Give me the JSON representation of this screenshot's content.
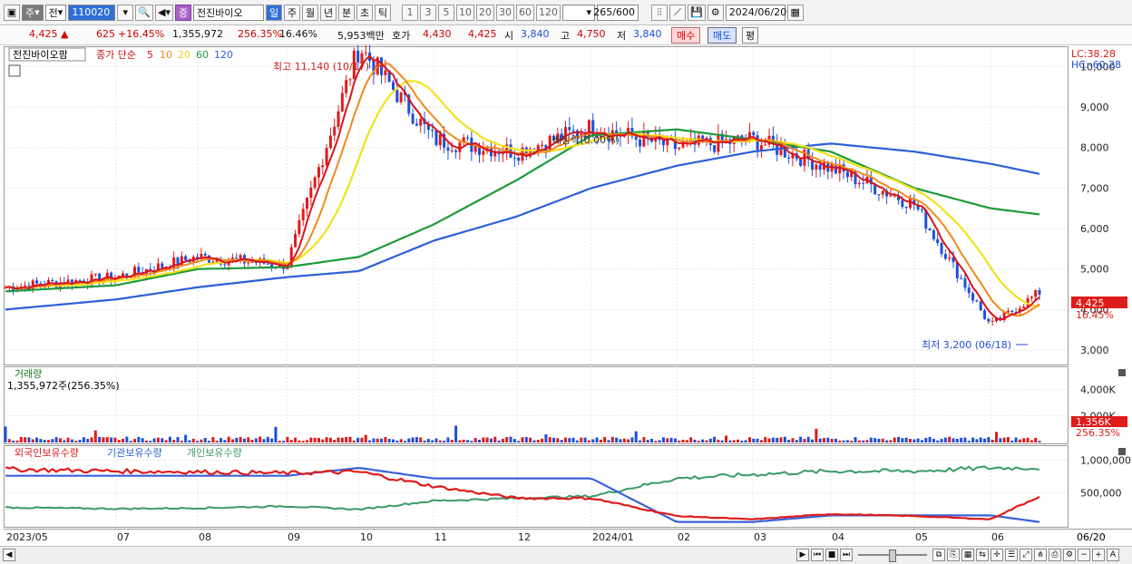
{
  "toolbar": {
    "period_label": "주",
    "market_label": "전",
    "stock_code": "110020",
    "badge_label": "증",
    "stock_name": "전진바이오",
    "tab_day": "일",
    "tab_week": "주",
    "tab_month": "월",
    "tab_year": "년",
    "tab_minute": "분",
    "tab_second": "초",
    "tab_tick": "틱",
    "intervals": [
      "1",
      "3",
      "5",
      "10",
      "20",
      "30",
      "60",
      "120"
    ],
    "count_value": "265",
    "count_total": "/600",
    "date_value": "2024/06/20"
  },
  "quote": {
    "price": "4,425",
    "change": "625",
    "change_pct": "+16.45%",
    "volume": "1,355,972",
    "volume_ratio": "256.35%",
    "turnover_pct": "16.46%",
    "amount": "5,953백만",
    "bid_label": "호가",
    "bid_high": "4,430",
    "bid_low": "4,425",
    "open_label": "시",
    "open_value": "3,840",
    "high_label": "고",
    "high_value": "4,750",
    "low_label": "저",
    "low_value": "3,840",
    "buy_label": "매수",
    "sell_label": "매도",
    "flat_label": "평"
  },
  "price_pane": {
    "title": "전진바이오팜",
    "indicator": "종가 단순",
    "ma_periods": [
      "5",
      "10",
      "20",
      "60",
      "120"
    ],
    "lc_label": "LC:38.28",
    "hc_label": "HC:-60.28",
    "max_label": "최고 11,140 (10/17)",
    "min_label": "최저 3,200 (06/18)",
    "event_label": "배당락(0.00%)",
    "current_price": "4,425",
    "current_pct": "16.45%",
    "y_ticks": [
      "10,000",
      "9,000",
      "8,000",
      "7,000",
      "6,000",
      "5,000",
      "4,000",
      "3,000"
    ]
  },
  "volume_pane": {
    "title": "거래량",
    "value": "1,355,972주(256.35%)",
    "y_ticks": [
      "4,000K",
      "2,000K"
    ],
    "current": "1,356K",
    "current_pct": "256.35%"
  },
  "holder_pane": {
    "foreign_label": "외국인보유수량",
    "inst_label": "기관보유수량",
    "indiv_label": "개인보유수량",
    "y_ticks": [
      "1,000,000",
      "500,000"
    ]
  },
  "x_axis": [
    "2023/05",
    "07",
    "08",
    "09",
    "10",
    "11",
    "12",
    "2024/01",
    "02",
    "03",
    "04",
    "05",
    "06"
  ],
  "x_end_label": "06/20",
  "colors": {
    "up": "#e01b1b",
    "down": "#1f4fd8",
    "ma5": "#d8141c",
    "ma10": "#f08a1c",
    "ma20": "#f2e21c",
    "ma60": "#1f9a3a",
    "ma120": "#2d5fd8",
    "foreign": "#e01b1b",
    "inst": "#3a62d8",
    "indiv": "#3a9a6a"
  },
  "chart_data": {
    "type": "candlestick",
    "price_range": [
      2800,
      10300
    ],
    "x": [
      "2023/05",
      "07",
      "08",
      "09",
      "10",
      "11",
      "12",
      "2024/01",
      "02",
      "03",
      "04",
      "05",
      "06",
      "06/20"
    ],
    "close": [
      4550,
      4800,
      5300,
      5100,
      10500,
      8200,
      7900,
      8500,
      8000,
      8200,
      7500,
      6600,
      3600,
      4425
    ],
    "ma60": [
      4450,
      4600,
      5000,
      5050,
      5300,
      6100,
      7200,
      8300,
      8450,
      8200,
      7900,
      7000,
      6500,
      6350
    ],
    "ma120": [
      4000,
      4250,
      4550,
      4800,
      4950,
      5700,
      6300,
      7000,
      7550,
      7900,
      8100,
      7900,
      7600,
      7350
    ],
    "volume_range": [
      0,
      4500000
    ],
    "holders_range": [
      0,
      1100000
    ]
  }
}
